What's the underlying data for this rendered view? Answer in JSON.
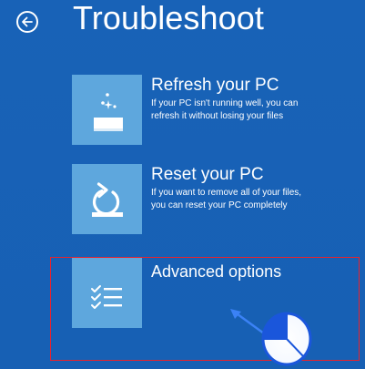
{
  "header": {
    "title": "Troubleshoot",
    "back_icon": "back-arrow-icon"
  },
  "options": [
    {
      "title": "Refresh your PC",
      "description_line1": "If your PC isn't running well, you can",
      "description_line2": "refresh it without losing your files",
      "icon": "refresh-sparkle-icon"
    },
    {
      "title": "Reset your PC",
      "description_line1": "If you want to remove all of your files,",
      "description_line2": "you can reset your PC completely",
      "icon": "reset-arrow-icon"
    },
    {
      "title": "Advanced options",
      "icon": "checklist-icon"
    }
  ],
  "annotation": {
    "highlight_color": "#e8232e",
    "arrow_color": "#3b82f6",
    "cursor_icon": "mouse-left-click-icon"
  },
  "colors": {
    "background": "#1761b7",
    "tile": "#5ea7dd",
    "text": "#ffffff"
  }
}
